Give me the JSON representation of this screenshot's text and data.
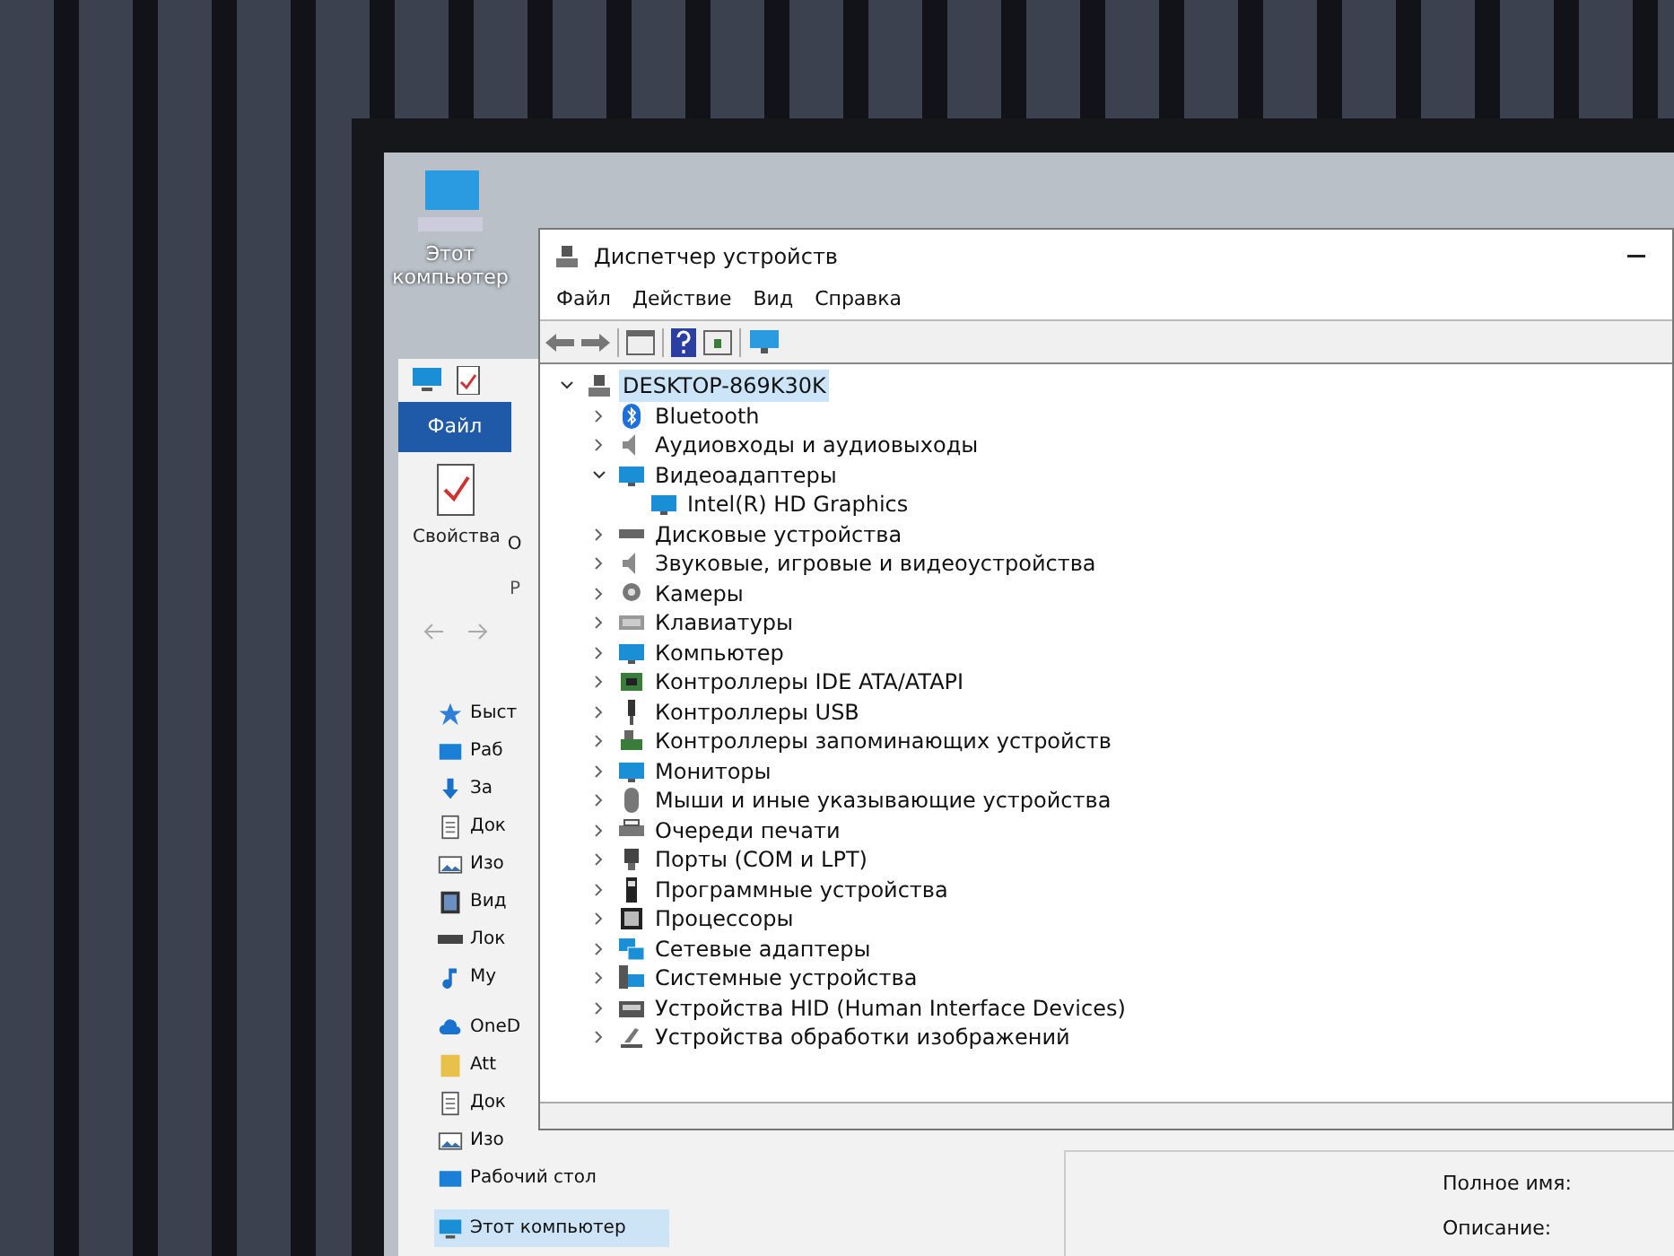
{
  "desktop_icon": {
    "label": "Этот компьютер"
  },
  "explorer": {
    "tab": "Файл",
    "ribbon_items": [
      "Свойства",
      "О"
    ],
    "ribbon_group": "Р",
    "nav_items": [
      {
        "label": "Быст",
        "kind": "star",
        "selected": false
      },
      {
        "label": "Раб",
        "kind": "desktop",
        "selected": false
      },
      {
        "label": "За",
        "kind": "download",
        "selected": false
      },
      {
        "label": "Док",
        "kind": "document",
        "selected": false
      },
      {
        "label": "Изо",
        "kind": "picture",
        "selected": false
      },
      {
        "label": "Вид",
        "kind": "video",
        "selected": false
      },
      {
        "label": "Лок",
        "kind": "drive",
        "selected": false
      },
      {
        "label": "Му",
        "kind": "music",
        "selected": false
      },
      {
        "label": "OneD",
        "kind": "cloud",
        "selected": false
      },
      {
        "label": "Att",
        "kind": "folder",
        "selected": false
      },
      {
        "label": "Док",
        "kind": "document",
        "selected": false
      },
      {
        "label": "Изо",
        "kind": "picture",
        "selected": false
      },
      {
        "label": "Рабочий стол",
        "kind": "desktop",
        "selected": false
      },
      {
        "label": "Этот компьютер",
        "kind": "computer",
        "selected": true
      }
    ],
    "details": [
      "Полное имя:",
      "Описание:"
    ]
  },
  "device_manager": {
    "title": "Диспетчер устройств",
    "menu": [
      "Файл",
      "Действие",
      "Вид",
      "Справка"
    ],
    "tree": {
      "label": "DESKTOP-869K30K",
      "kind": "computer",
      "expanded": true,
      "selected": true,
      "children": [
        {
          "label": "Bluetooth",
          "kind": "bluetooth",
          "expanded": false,
          "selected": false
        },
        {
          "label": "Аудиовходы и аудиовыходы",
          "kind": "speaker",
          "expanded": false,
          "selected": false
        },
        {
          "label": "Видеоадаптеры",
          "kind": "display",
          "expanded": true,
          "selected": false,
          "children": [
            {
              "label": "Intel(R) HD Graphics",
              "kind": "display",
              "selected": false
            }
          ]
        },
        {
          "label": "Дисковые устройства",
          "kind": "disk",
          "expanded": false,
          "selected": false
        },
        {
          "label": "Звуковые, игровые и видеоустройства",
          "kind": "speaker",
          "expanded": false,
          "selected": false
        },
        {
          "label": "Камеры",
          "kind": "camera",
          "expanded": false,
          "selected": false
        },
        {
          "label": "Клавиатуры",
          "kind": "keyboard",
          "expanded": false,
          "selected": false
        },
        {
          "label": "Компьютер",
          "kind": "monitor",
          "expanded": false,
          "selected": false
        },
        {
          "label": "Контроллеры IDE ATA/ATAPI",
          "kind": "card",
          "expanded": false,
          "selected": false
        },
        {
          "label": "Контроллеры USB",
          "kind": "usb",
          "expanded": false,
          "selected": false
        },
        {
          "label": "Контроллеры запоминающих устройств",
          "kind": "storage",
          "expanded": false,
          "selected": false
        },
        {
          "label": "Мониторы",
          "kind": "monitor",
          "expanded": false,
          "selected": false
        },
        {
          "label": "Мыши и иные указывающие устройства",
          "kind": "mouse",
          "expanded": false,
          "selected": false
        },
        {
          "label": "Очереди печати",
          "kind": "printer",
          "expanded": false,
          "selected": false
        },
        {
          "label": "Порты (COM и LPT)",
          "kind": "port",
          "expanded": false,
          "selected": false
        },
        {
          "label": "Программные устройства",
          "kind": "firmware",
          "expanded": false,
          "selected": false
        },
        {
          "label": "Процессоры",
          "kind": "cpu",
          "expanded": false,
          "selected": false
        },
        {
          "label": "Сетевые адаптеры",
          "kind": "network",
          "expanded": false,
          "selected": false
        },
        {
          "label": "Системные устройства",
          "kind": "system",
          "expanded": false,
          "selected": false
        },
        {
          "label": "Устройства HID (Human Interface Devices)",
          "kind": "hid",
          "expanded": false,
          "selected": false
        },
        {
          "label": "Устройства обработки изображений",
          "kind": "imaging",
          "expanded": false,
          "selected": false
        }
      ]
    }
  }
}
